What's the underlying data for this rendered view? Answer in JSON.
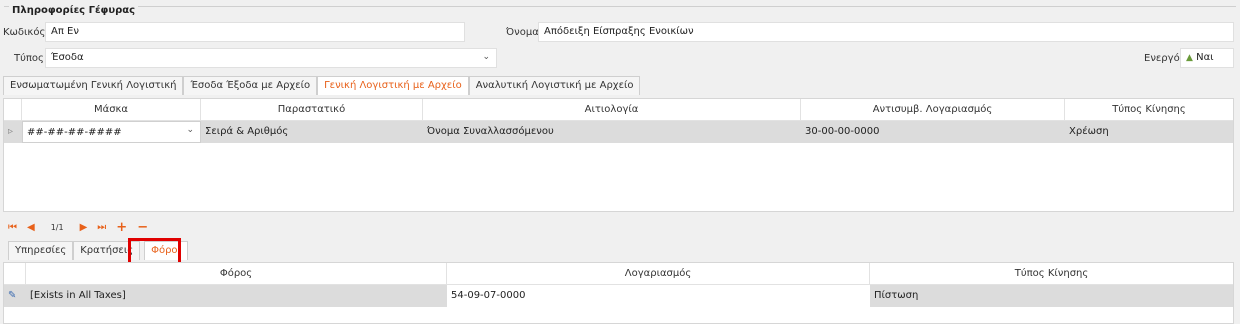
{
  "group": {
    "title": "Πληροφορίες Γέφυρας"
  },
  "form": {
    "code_label": "Κωδικός",
    "code_value": "Απ Εν",
    "name_label": "Όνομα",
    "name_value": "Απόδειξη Είσπραξης Ενοικίων",
    "type_label": "Τύπος",
    "type_value": "Έσοδα",
    "active_label": "Ενεργό",
    "active_value": "Ναι"
  },
  "tabs": [
    {
      "label": "Ενσωματωμένη Γενική Λογιστική",
      "active": false
    },
    {
      "label": "Έσοδα Έξοδα με Αρχείο",
      "active": false
    },
    {
      "label": "Γενική Λογιστική με Αρχείο",
      "active": true
    },
    {
      "label": "Αναλυτική Λογιστική με Αρχείο",
      "active": false
    }
  ],
  "main_grid": {
    "columns": [
      "Μάσκα",
      "Παραστατικό",
      "Αιτιολογία",
      "Αντισυμβ. Λογαριασμός",
      "Τύπος Κίνησης"
    ],
    "rows": [
      [
        "##-##-##-####",
        "Σειρά & Αριθμός",
        "Όνομα Συναλλασσόμενου",
        "30-00-00-0000",
        "Χρέωση"
      ]
    ]
  },
  "pager": {
    "page": "1/1"
  },
  "subtabs": [
    {
      "label": "Υπηρεσίες",
      "active": false
    },
    {
      "label": "Κρατήσεις",
      "active": false
    },
    {
      "label": "Φόροι",
      "active": true
    }
  ],
  "tax_grid": {
    "columns": [
      "Φόρος",
      "Λογαριασμός",
      "Τύπος Κίνησης"
    ],
    "rows": [
      [
        "[Exists in All Taxes]",
        "54-09-07-0000",
        "Πίστωση"
      ]
    ]
  },
  "colors": {
    "accent": "#e8611a",
    "highlight": "#e00000",
    "selected_row": "#dcdcdc"
  }
}
